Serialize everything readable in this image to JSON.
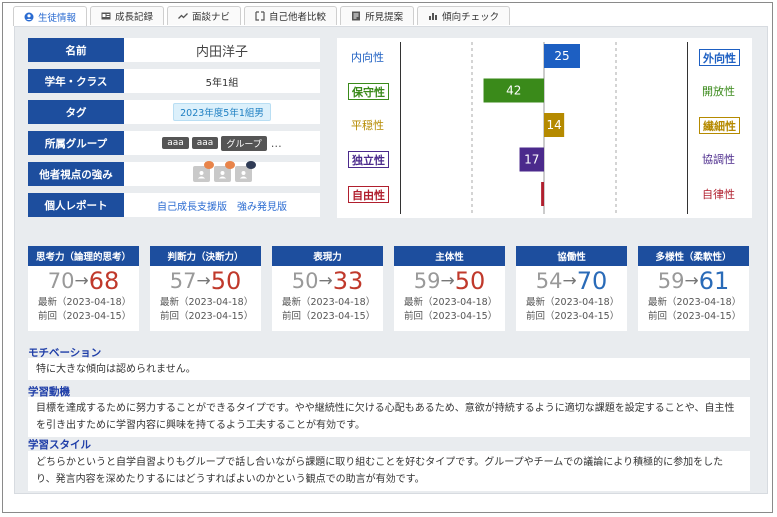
{
  "tabs": [
    {
      "label": "生徒情報",
      "icon": "user-circle-icon",
      "active": true
    },
    {
      "label": "成長記録",
      "icon": "id-card-icon",
      "active": false
    },
    {
      "label": "面談ナビ",
      "icon": "trend-icon",
      "active": false
    },
    {
      "label": "自己他者比較",
      "icon": "compare-icon",
      "active": false
    },
    {
      "label": "所見提案",
      "icon": "document-icon",
      "active": false
    },
    {
      "label": "傾向チェック",
      "icon": "bar-chart-icon",
      "active": false
    }
  ],
  "info": {
    "name_label": "名前",
    "name_value": "内田洋子",
    "class_label": "学年・クラス",
    "class_value": "5年1組",
    "tag_label": "タグ",
    "tag_value": "2023年度5年1組男",
    "group_label": "所属グループ",
    "groups": [
      "aaa",
      "aaa",
      "グループ"
    ],
    "groups_more": "…",
    "strength_label": "他者視点の強み",
    "report_label": "個人レポート",
    "report_links": [
      "自己成長支援版",
      "強み発見版"
    ]
  },
  "traits_left": [
    "内向性",
    "保守性",
    "平穏性",
    "独立性",
    "自由性"
  ],
  "traits_right": [
    "外向性",
    "開放性",
    "繊細性",
    "協調性",
    "自律性"
  ],
  "chart_data": {
    "type": "bar",
    "orientation": "diverging-horizontal",
    "categories": [
      "内向性 / 外向性",
      "保守性 / 開放性",
      "平穏性 / 繊細性",
      "独立性 / 協調性",
      "自由性 / 自律性"
    ],
    "values": [
      25,
      -42,
      14,
      -17,
      -2
    ],
    "value_labels": [
      "25",
      "42",
      "14",
      "17",
      ""
    ],
    "colors": [
      "#1d5fc2",
      "#3a8a1a",
      "#b58a00",
      "#4b2a8c",
      "#b01f2e"
    ],
    "xlim": [
      -100,
      100
    ],
    "grid": "dashed vertical at ±50"
  },
  "scores": [
    {
      "title": "思考力（論理的思考）",
      "prev": "70",
      "arrow": "→",
      "current": "68",
      "color": "#c0392b",
      "latest": "最新（2023-04-18）",
      "previous": "前回（2023-04-15）"
    },
    {
      "title": "判断力（決断力）",
      "prev": "57",
      "arrow": "→",
      "current": "50",
      "color": "#c0392b",
      "latest": "最新（2023-04-18）",
      "previous": "前回（2023-04-15）"
    },
    {
      "title": "表現力",
      "prev": "50",
      "arrow": "→",
      "current": "33",
      "color": "#c0392b",
      "latest": "最新（2023-04-18）",
      "previous": "前回（2023-04-15）"
    },
    {
      "title": "主体性",
      "prev": "59",
      "arrow": "→",
      "current": "50",
      "color": "#c0392b",
      "latest": "最新（2023-04-18）",
      "previous": "前回（2023-04-15）"
    },
    {
      "title": "協働性",
      "prev": "54",
      "arrow": "→",
      "current": "70",
      "color": "#2a6bb8",
      "latest": "最新（2023-04-18）",
      "previous": "前回（2023-04-15）"
    },
    {
      "title": "多様性（柔軟性）",
      "prev": "59",
      "arrow": "→",
      "current": "61",
      "color": "#2a6bb8",
      "latest": "最新（2023-04-18）",
      "previous": "前回（2023-04-15）"
    }
  ],
  "sections": {
    "motivation_title": "モチベーション",
    "motivation_text": "特に大きな傾向は認められません。",
    "learning_motive_title": "学習動機",
    "learning_motive_text": "目標を達成するために努力することができるタイプです。やや継続性に欠ける心配もあるため、意欲が持続するように適切な課題を設定することや、自主性を引き出すために学習内容に興味を持てるよう工夫することが有効です。",
    "learning_style_title": "学習スタイル",
    "learning_style_text": "どちらかというと自学自習よりもグループで話し合いながら課題に取り組むことを好むタイプです。グループやチームでの議論により積極的に参加をしたり、発言内容を深めたりするにはどうすればよいのかという観点での助言が有効です。"
  }
}
